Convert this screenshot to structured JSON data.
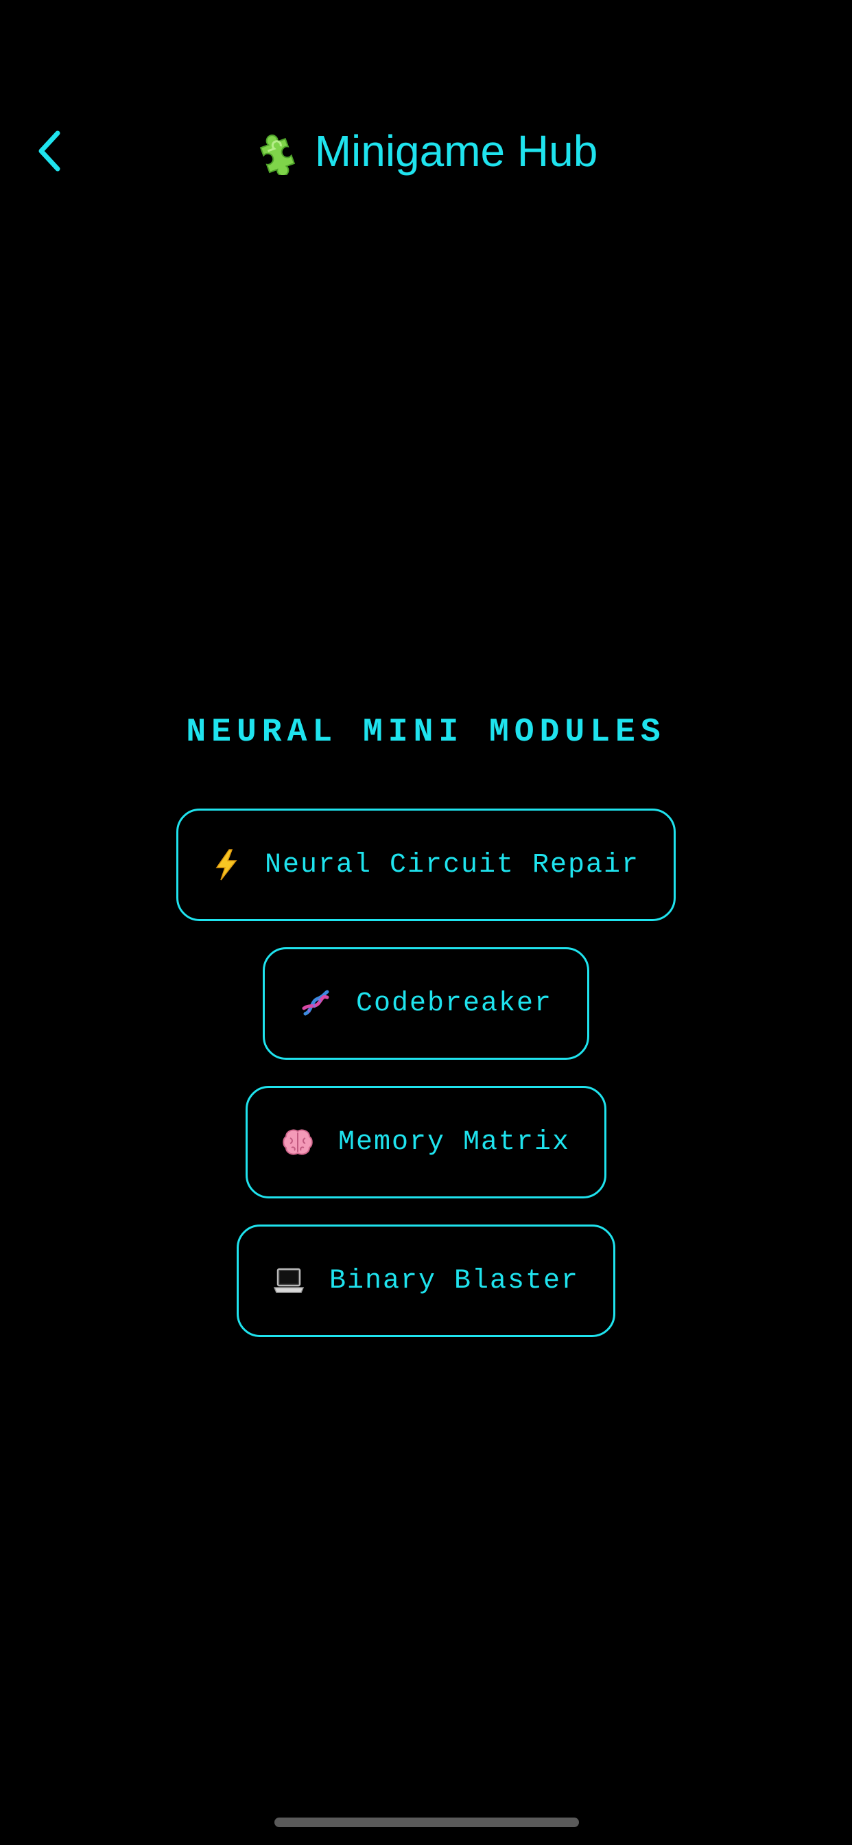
{
  "nav": {
    "title": "Minigame Hub",
    "back_icon": "chevron-left-icon",
    "title_icon": "puzzle-piece-icon"
  },
  "section": {
    "heading": "NEURAL MINI MODULES"
  },
  "modules": [
    {
      "label": "Neural Circuit Repair",
      "icon": "lightning-icon"
    },
    {
      "label": "Codebreaker",
      "icon": "dna-icon"
    },
    {
      "label": "Memory Matrix",
      "icon": "brain-icon"
    },
    {
      "label": "Binary Blaster",
      "icon": "laptop-icon"
    }
  ],
  "colors": {
    "accent": "#1fe3ee",
    "background": "#000000"
  }
}
